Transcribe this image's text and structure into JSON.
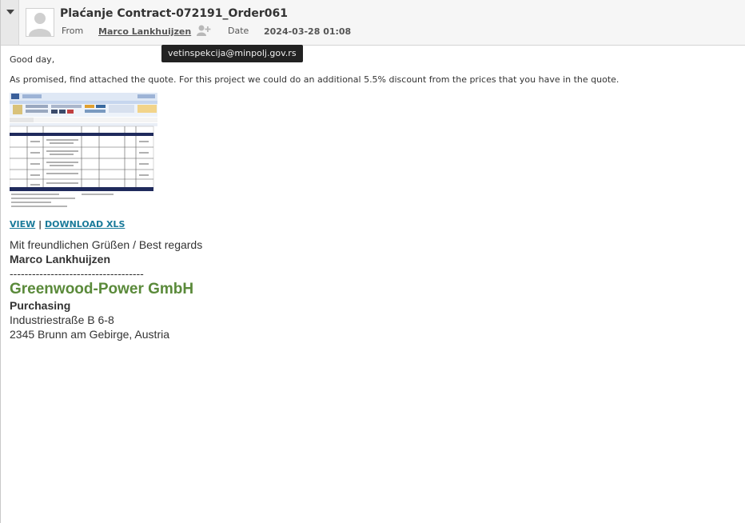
{
  "email": {
    "subject": "Plaćanje Contract-072191_Order061",
    "from_label": "From",
    "from_name": "Marco Lankhuijzen",
    "from_address_tooltip": "vetinspekcija@minpolj.gov.rs",
    "date_label": "Date",
    "date_value": "2024-03-28 01:08"
  },
  "body": {
    "greeting": "Good day,",
    "message": "As promised, find attached the quote. For this project we could do an additional 5.5% discount from the prices that you have in the quote.",
    "attachment": {
      "view_label": "VIEW",
      "separator": "|",
      "download_label": "DOWNLOAD XLS"
    }
  },
  "signature": {
    "regards": "Mit freundlichen Grüßen / Best regards",
    "name": "Marco Lankhuijzen",
    "divider": "------------------------------------",
    "company": "Greenwood-Power GmbH",
    "department": "Purchasing",
    "street": "Industriestraße B 6-8",
    "city": "2345 Brunn am Gebirge, Austria"
  },
  "icons": {
    "collapse": "chevron-down-icon",
    "avatar": "user-avatar-icon",
    "add_contact": "add-contact-icon"
  },
  "colors": {
    "link": "#1a7a9a",
    "company": "#5a8a3a",
    "tooltip_bg": "#222222",
    "header_bg": "#f6f6f6",
    "spreadsheet_header": "#1f2a5c"
  }
}
